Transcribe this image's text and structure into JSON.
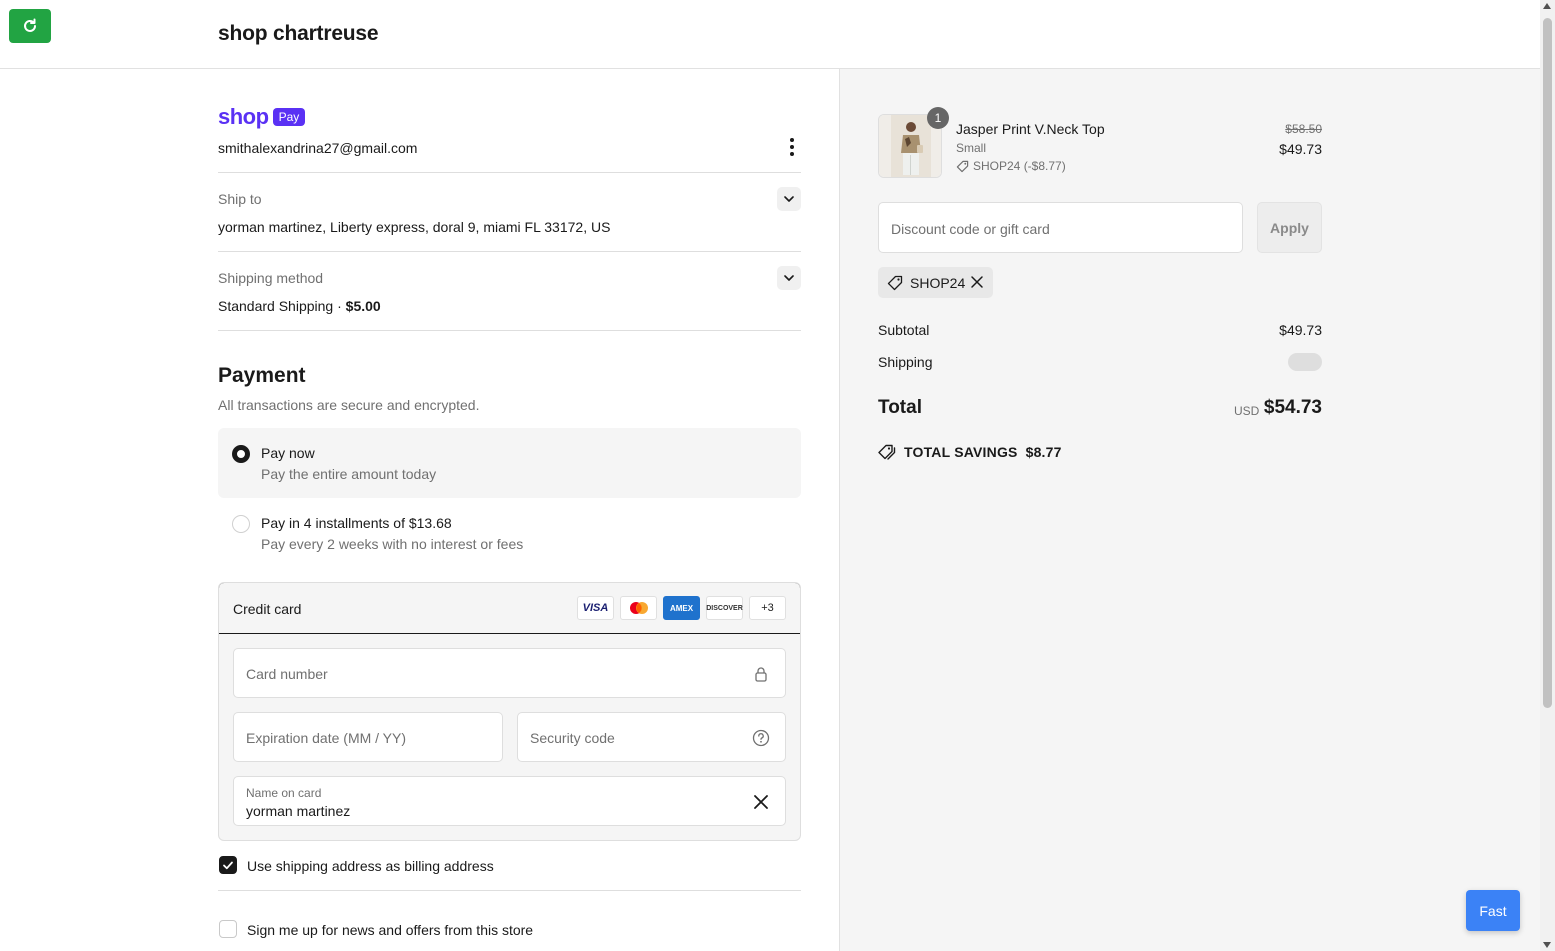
{
  "header": {
    "store_name": "shop chartreuse"
  },
  "shop_pay": {
    "shop": "shop",
    "pay": "Pay",
    "email": "smithalexandrina27@gmail.com"
  },
  "ship_to": {
    "label": "Ship to",
    "value": "yorman martinez, Liberty express, doral 9, miami FL 33172, US"
  },
  "shipping_method": {
    "label": "Shipping method",
    "name": "Standard Shipping",
    "separator": " · ",
    "price": "$5.00"
  },
  "payment": {
    "title": "Payment",
    "subtitle": "All transactions are secure and encrypted.",
    "options": [
      {
        "title": "Pay now",
        "subtitle": "Pay the entire amount today",
        "selected": true
      },
      {
        "title": "Pay in 4 installments of $13.68",
        "subtitle": "Pay every 2 weeks with no interest or fees",
        "selected": false
      }
    ],
    "credit_card": {
      "title": "Credit card",
      "brands": [
        "VISA",
        "mastercard",
        "AMEX",
        "DISCOVER"
      ],
      "more": "+3",
      "card_number_placeholder": "Card number",
      "expiration_placeholder": "Expiration date (MM / YY)",
      "security_placeholder": "Security code",
      "name_label": "Name on card",
      "name_value": "yorman martinez"
    },
    "billing_same": {
      "label": "Use shipping address as billing address",
      "checked": true
    },
    "newsletter": {
      "label": "Sign me up for news and offers from this store",
      "checked": false
    }
  },
  "order": {
    "item": {
      "quantity": "1",
      "name": "Jasper Print V.Neck Top",
      "variant": "Small",
      "discount": "SHOP24 (-$8.77)",
      "original_price": "$58.50",
      "price": "$49.73"
    },
    "discount_placeholder": "Discount code or gift card",
    "apply_label": "Apply",
    "applied_code": "SHOP24",
    "subtotal_label": "Subtotal",
    "subtotal_value": "$49.73",
    "shipping_label": "Shipping",
    "total_label": "Total",
    "currency": "USD",
    "total_value": "$54.73",
    "savings_label": "TOTAL SAVINGS",
    "savings_value": "$8.77"
  },
  "fast_button": "Fast",
  "colors": {
    "shop_pay": "#5a31f4",
    "refresh": "#22a443",
    "fast": "#3b82f6"
  }
}
